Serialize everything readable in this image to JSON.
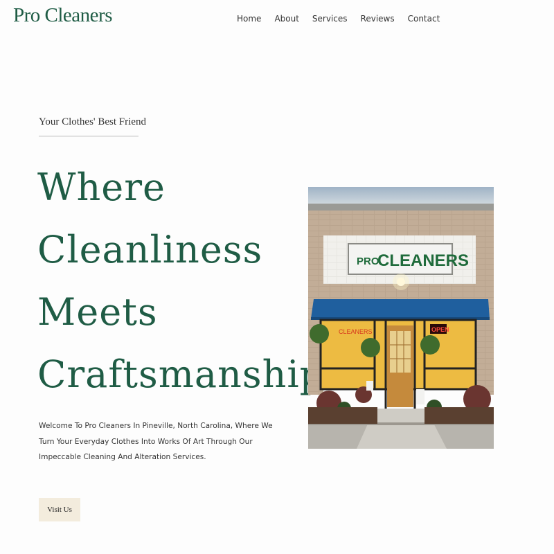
{
  "header": {
    "logo": "Pro Cleaners",
    "nav": [
      "Home",
      "About",
      "Services",
      "Reviews",
      "Contact"
    ]
  },
  "hero": {
    "eyebrow": "Your Clothes' Best Friend",
    "headline": [
      "Where",
      "Cleanliness",
      "Meets",
      "Craftsmanship"
    ],
    "intro": "Welcome To Pro Cleaners In Pineville, North Carolina, Where We Turn Your Everyday Clothes Into Works Of Art Through Our Impeccable Cleaning And Alteration Services.",
    "cta_label": "Visit Us"
  },
  "photo": {
    "sign_text_small": "PRO",
    "sign_text_large": "CLEANERS",
    "window_sign": "CLEANERS",
    "open_sign": "OPEN"
  },
  "colors": {
    "brand_green": "#1f5c45",
    "cta_bg": "#f3ecdd",
    "awning_blue": "#1f5f9e"
  }
}
